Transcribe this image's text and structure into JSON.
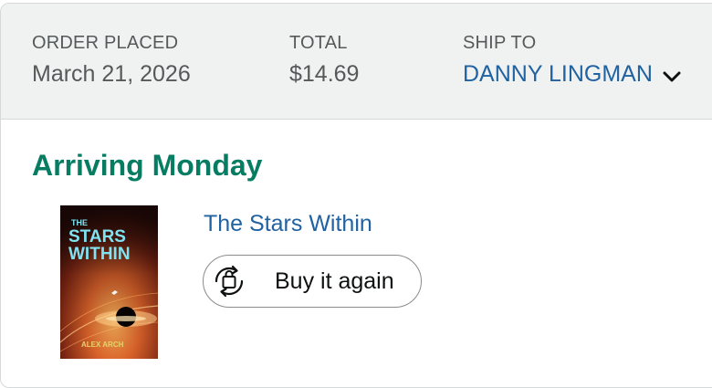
{
  "header": {
    "order_placed": {
      "label": "ORDER PLACED",
      "value": "March 21, 2026"
    },
    "total": {
      "label": "TOTAL",
      "value": "$14.69"
    },
    "ship_to": {
      "label": "SHIP TO",
      "name": "DANNY LINGMAN",
      "icon": "chevron-down-icon"
    }
  },
  "shipment": {
    "status": "Arriving Monday",
    "status_color": "#067d62"
  },
  "item": {
    "title": "The Stars Within",
    "cover": {
      "title_line1": "THE",
      "title_line2": "STARS",
      "title_line3": "WITHIN",
      "author": "ALEX ARCH"
    },
    "buy_again_label": "Buy it again",
    "buy_again_icon": "reorder-bag-icon"
  },
  "colors": {
    "link": "#2162a1",
    "header_bg": "#f0f2f2",
    "muted_text": "#565959"
  }
}
